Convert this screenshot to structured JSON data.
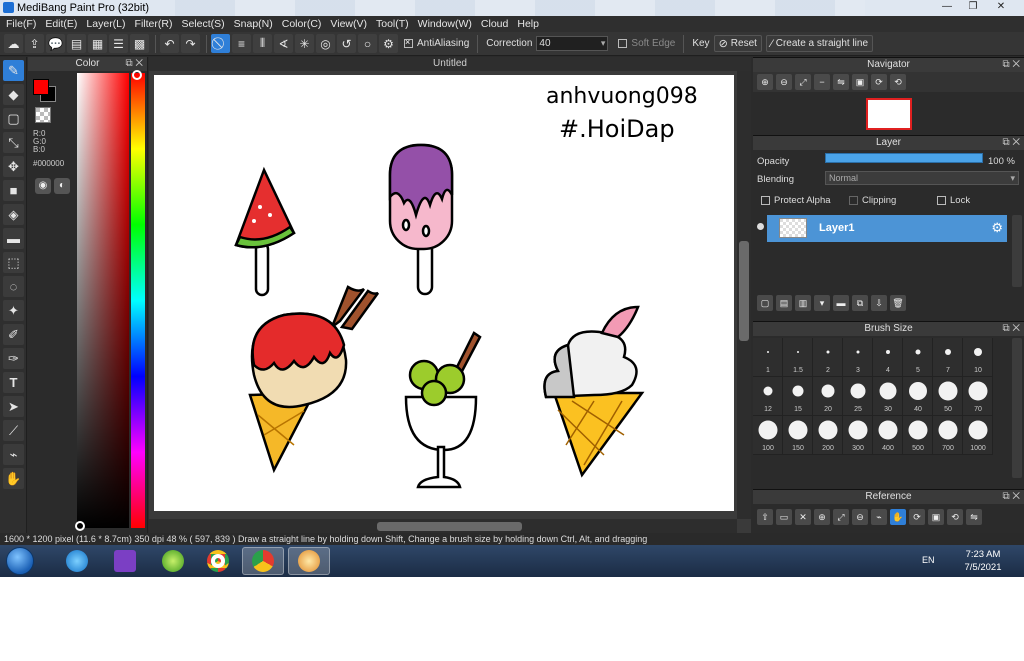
{
  "window": {
    "title": "MediBang Paint Pro (32bit)",
    "minimize": "—",
    "maximize": "❐",
    "close": "✕"
  },
  "menu": [
    "File(F)",
    "Edit(E)",
    "Layer(L)",
    "Filter(R)",
    "Select(S)",
    "Snap(N)",
    "Color(C)",
    "View(V)",
    "Tool(T)",
    "Window(W)",
    "Cloud",
    "Help"
  ],
  "toolbar": {
    "antialiasing_label": "AntiAliasing",
    "correction_label": "Correction",
    "correction_value": "40",
    "soft_edge_label": "Soft Edge",
    "key_label": "Key",
    "reset_label": "Reset",
    "straight_line_label": "Create a straight line"
  },
  "color_panel": {
    "title": "Color",
    "r": "R:0",
    "g": "G:0",
    "b": "B:0",
    "hex": "#000000",
    "foreground": "#ff0000",
    "background": "#000000"
  },
  "document": {
    "tab_title": "Untitled",
    "signature_line1": "anhvuong098",
    "signature_line2": "#.HoiDap"
  },
  "navigator": {
    "title": "Navigator"
  },
  "layer_panel": {
    "title": "Layer",
    "opacity_label": "Opacity",
    "opacity_value": "100 %",
    "opacity_fraction": 1.0,
    "blending_label": "Blending",
    "blending_value": "Normal",
    "protect_alpha_label": "Protect Alpha",
    "clipping_label": "Clipping",
    "lock_label": "Lock",
    "layer_name": "Layer1"
  },
  "brush_size": {
    "title": "Brush Size",
    "sizes": [
      "1",
      "1.5",
      "2",
      "3",
      "4",
      "5",
      "7",
      "10",
      "12",
      "15",
      "20",
      "25",
      "30",
      "40",
      "50",
      "70",
      "100",
      "150",
      "200",
      "300",
      "400",
      "500",
      "700",
      "1000"
    ]
  },
  "reference": {
    "title": "Reference"
  },
  "status": {
    "text": "1600 * 1200 pixel   (11.6 * 8.7cm)  350 dpi   48 %   ( 597, 839 )   Draw a straight line by holding down Shift, Change a brush size by holding down Ctrl, Alt, and dragging"
  },
  "taskbar": {
    "language": "EN",
    "time": "7:23 AM",
    "date": "7/5/2021"
  }
}
